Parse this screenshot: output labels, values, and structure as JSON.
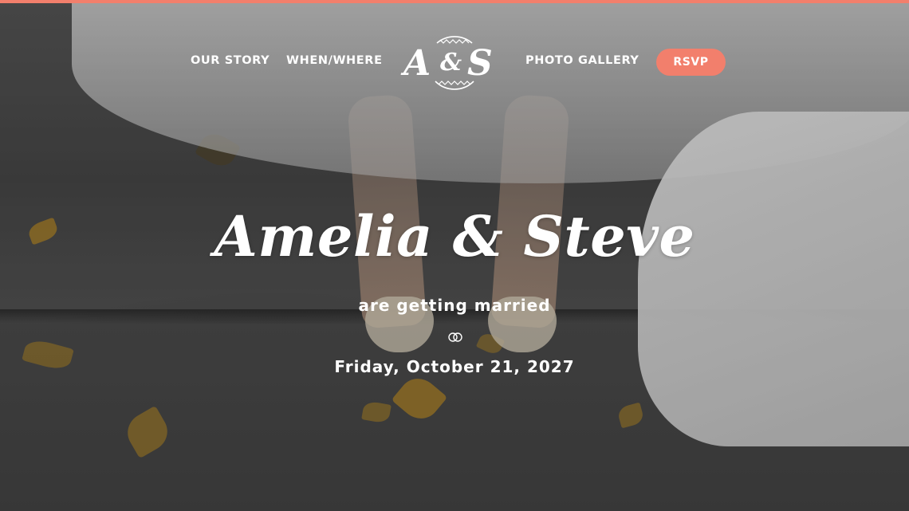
{
  "nav": {
    "links": [
      "OUR STORY",
      "WHEN/WHERE",
      "PHOTO GALLERY"
    ],
    "monogram": {
      "left": "A",
      "amp": "&",
      "right": "S"
    },
    "rsvp_label": "RSVP"
  },
  "hero": {
    "couple_names": "Amelia & Steve",
    "tagline": "are getting married",
    "date": "Friday, October 21, 2027"
  },
  "icons": {
    "divider": "rings-icon",
    "logo": "monogram-logo"
  },
  "colors": {
    "accent": "#f27f6c",
    "text": "#ffffff"
  }
}
